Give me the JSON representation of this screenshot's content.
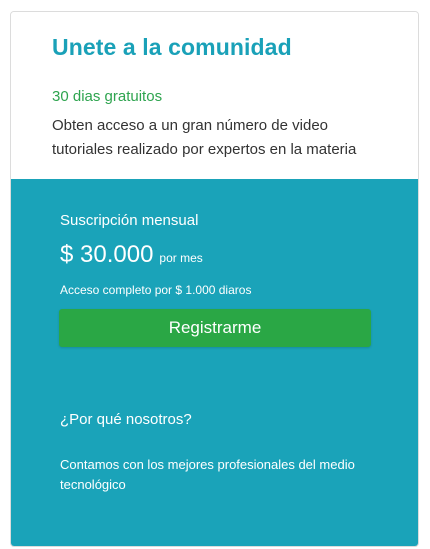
{
  "header": {
    "title": "Unete a la comunidad",
    "subtitle": "30 dias gratuitos",
    "description": "Obten acceso a un gran número de video tutoriales realizado por expertos en la materia"
  },
  "plan": {
    "name": "Suscripción mensual",
    "price": "$ 30.000",
    "period": "por mes",
    "access_note": "Acceso completo por $ 1.000 diaros",
    "register_label": "Registrarme"
  },
  "why": {
    "heading": "¿Por qué nosotros?",
    "text": "Contamos con los mejores profesionales del medio tecnológico"
  },
  "colors": {
    "title": "#1aa1b8",
    "subtitle": "#2ea44f",
    "panel_bg": "#1aa3b9",
    "button_bg": "#2aa745"
  }
}
